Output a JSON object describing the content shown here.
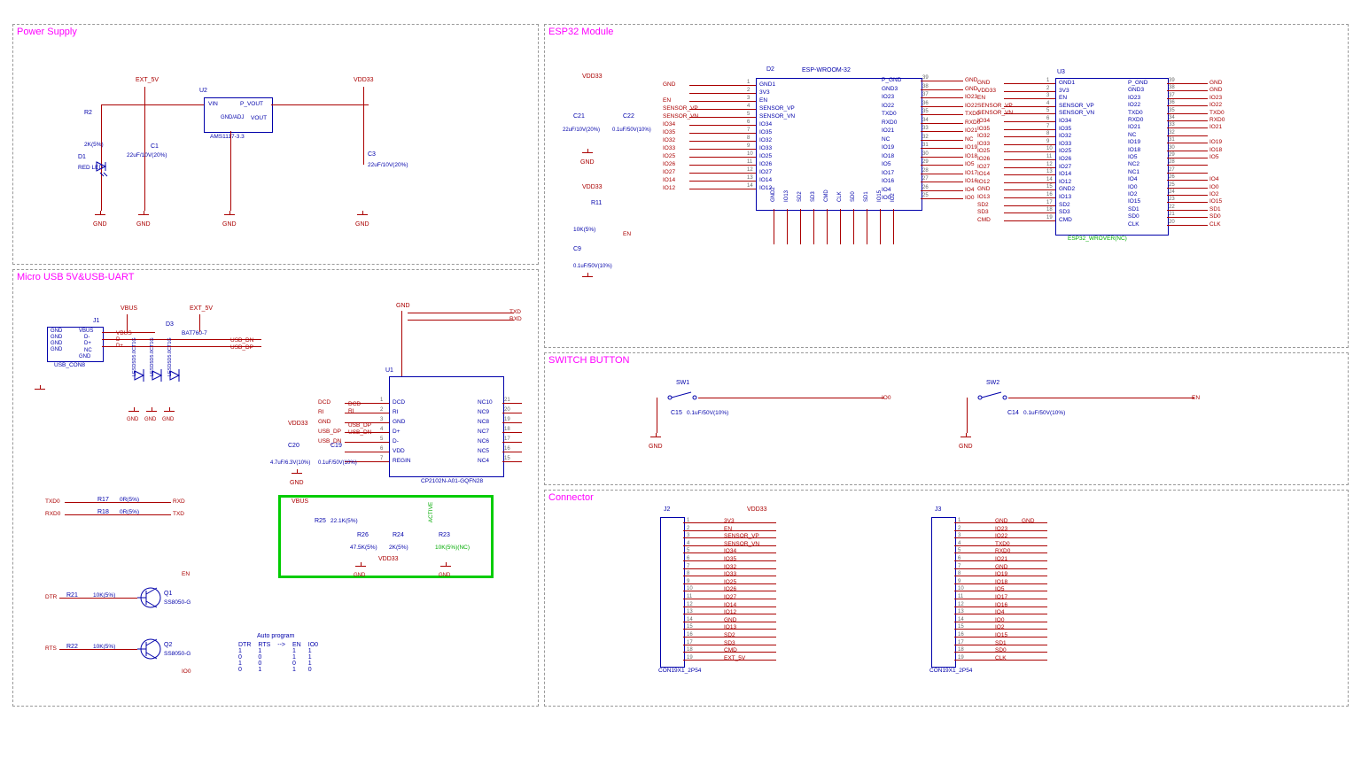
{
  "sheets": {
    "power": {
      "title": "Power Supply"
    },
    "usb": {
      "title": "Micro USB  5V&USB-UART"
    },
    "esp": {
      "title": "ESP32 Module"
    },
    "switch": {
      "title": "SWITCH BUTTON"
    },
    "conn": {
      "title": "Connector"
    }
  },
  "power": {
    "ext5v": "EXT_5V",
    "vdd33": "VDD33",
    "r2": "R2",
    "r2v": "2K(5%)",
    "d1": "D1",
    "d1v": "RED LED",
    "c1": "C1",
    "c1v": "22uF/10V(20%)",
    "c3": "C3",
    "c3v": "22uF/10V(20%)",
    "u2": "U2",
    "u2v": "AMS1117-3.3",
    "vin": "VIN",
    "gnd": "GND",
    "adj": "GND/ADJ",
    "vout": "VOUT",
    "pvout": "P_VOUT"
  },
  "usb": {
    "j1": "J1",
    "j1v": "USB_CON8",
    "vbus": "VBUS",
    "ext5v": "EXT_5V",
    "d3": "D3",
    "d3v": "BAT760-7",
    "usbdn": "USB_DN",
    "usbdp": "USB_DP",
    "d4": "LESD5D5.0CT1G",
    "d5": "LESD5D5.0CT1G",
    "d6": "LESD5D5.0CT1G",
    "vdd33": "VDD33",
    "c20": "C20",
    "c20v": "4.7uF/6.3V(10%)",
    "c19": "C19",
    "c19v": "0.1uF/50V(10%)",
    "u1": "U1",
    "u1v": "CP2102N-A01-GQFN28",
    "r17": "R17",
    "r17v": "0R(5%)",
    "r18": "R18",
    "r18v": "0R(5%)",
    "txd0": "TXD0",
    "rxd0": "RXD0",
    "rxd": "RXD",
    "txd": "TXD",
    "r25": "R25",
    "r25v": "22.1K(5%)",
    "r26": "R26",
    "r26v": "47.5K(5%)",
    "r24": "R24",
    "r24v": "2K(5%)",
    "r23": "R23",
    "r23v": "10K(5%)(NC)",
    "r21": "R21",
    "r21v": "10K(5%)",
    "r22": "R22",
    "r22v": "10K(5%)",
    "q1": "Q1",
    "q1v": "SS8050-G",
    "q2": "Q2",
    "q2v": "SS8050-G",
    "dtr": "DTR",
    "rts": "RTS",
    "en": "EN",
    "io0": "IO0",
    "auto_title": "Auto program",
    "auto_hdr": [
      "DTR",
      "RTS",
      "-->",
      "EN",
      "IO0"
    ],
    "auto_rows": [
      [
        "1",
        "1",
        "",
        "1",
        "1"
      ],
      [
        "0",
        "0",
        "",
        "1",
        "1"
      ],
      [
        "1",
        "0",
        "",
        "0",
        "1"
      ],
      [
        "0",
        "1",
        "",
        "1",
        "0"
      ]
    ],
    "dcd": "DCD",
    "ri": "RI",
    "dplus": "D+",
    "dminus": "D-",
    "vdd": "VDD",
    "regin": "REGIN",
    "pins_left": [
      "DCD",
      "RI",
      "GND",
      "D+",
      "D-",
      "VDD",
      "REGIN"
    ],
    "pins_right": [
      "NC10",
      "NC9",
      "NC8",
      "NC7",
      "NC6",
      "NC5",
      "NC4"
    ],
    "active": "ACTIVE",
    "gnd": "GND"
  },
  "esp": {
    "d2": "D2",
    "vdd33": "VDD33",
    "c21": "C21",
    "c21v": "22uF/10V(20%)",
    "c22": "C22",
    "c22v": "0.1uF/50V(10%)",
    "r11": "R11",
    "r11v": "10K(5%)",
    "c9": "C9",
    "c9v": "0.1uF/50V(10%)",
    "en": "EN",
    "wroom": "ESP-WROOM-32",
    "u3": "U3",
    "wrover": "ESP32_WROVER(NC)",
    "left_pins": [
      "GND1",
      "3V3",
      "EN",
      "SENSOR_VP",
      "SENSOR_VN",
      "IO34",
      "IO35",
      "IO32",
      "IO33",
      "IO25",
      "IO26",
      "IO27",
      "IO14",
      "IO12"
    ],
    "left_nets": [
      "GND",
      "",
      "EN",
      "SENSOR_VP",
      "SENSOR_VN",
      "IO34",
      "IO35",
      "IO32",
      "IO33",
      "IO25",
      "IO26",
      "IO27",
      "IO14",
      "IO12"
    ],
    "right_pins": [
      "P_GND",
      "GND3",
      "IO23",
      "IO22",
      "TXD0",
      "RXD0",
      "IO21",
      "NC",
      "IO19",
      "IO18",
      "IO5",
      "IO17",
      "IO16",
      "IO4",
      "IO0"
    ],
    "right_nets": [
      "GND",
      "GND",
      "IO23",
      "IO22",
      "TXD0",
      "RXD0",
      "IO21",
      "NC",
      "IO19",
      "IO18",
      "IO5",
      "IO17",
      "IO16",
      "IO4",
      "IO0"
    ],
    "bot_pins": [
      "GND2",
      "IO13",
      "SD2",
      "SD3",
      "CMD",
      "CLK",
      "SD0",
      "SD1",
      "IO15",
      "IO2"
    ],
    "u3_left": [
      "GND1",
      "3V3",
      "EN",
      "SENSOR_VP",
      "SENSOR_VN",
      "IO34",
      "IO35",
      "IO32",
      "IO33",
      "IO25",
      "IO26",
      "IO27",
      "IO14",
      "IO12",
      "GND2",
      "IO13",
      "SD2",
      "SD3",
      "CMD"
    ],
    "u3_right": [
      "P_GND",
      "GND3",
      "IO23",
      "IO22",
      "TXD0",
      "RXD0",
      "IO21",
      "NC",
      "IO19",
      "IO18",
      "IO5",
      "NC2",
      "NC1",
      "IO4",
      "IO0",
      "IO2",
      "IO15",
      "SD1",
      "SD0",
      "CLK"
    ],
    "u3_left_nets": [
      "GND",
      "VDD33",
      "EN",
      "SENSOR_VP",
      "SENSOR_VN",
      "IO34",
      "IO35",
      "IO32",
      "IO33",
      "IO25",
      "IO26",
      "IO27",
      "IO14",
      "IO12",
      "GND",
      "IO13",
      "SD2",
      "SD3",
      "CMD"
    ],
    "u3_right_nets": [
      "GND",
      "GND",
      "IO23",
      "IO22",
      "TXD0",
      "RXD0",
      "IO21",
      "",
      "IO19",
      "IO18",
      "IO5",
      "",
      "",
      "IO4",
      "IO0",
      "IO2",
      "IO15",
      "SD1",
      "SD0",
      "CLK"
    ],
    "gnd": "GND"
  },
  "switch": {
    "sw1": "SW1",
    "sw2": "SW2",
    "c15": "C15",
    "c15v": "0.1uF/50V(10%)",
    "c14": "C14",
    "c14v": "0.1uF/50V(10%)",
    "io0": "IO0",
    "en": "EN",
    "gnd": "GND"
  },
  "conn": {
    "j2": "J2",
    "j3": "J3",
    "vdd33": "VDD33",
    "contype": "CON19X1_2P54",
    "j2_nets": [
      "3V3",
      "EN",
      "SENSOR_VP",
      "SENSOR_VN",
      "IO34",
      "IO35",
      "IO32",
      "IO33",
      "IO25",
      "IO26",
      "IO27",
      "IO14",
      "IO12",
      "GND",
      "IO13",
      "SD2",
      "SD3",
      "CMD",
      "EXT_5V"
    ],
    "j3_nets": [
      "GND",
      "IO23",
      "IO22",
      "TXD0",
      "RXD0",
      "IO21",
      "GND",
      "IO19",
      "IO18",
      "IO5",
      "IO17",
      "IO16",
      "IO4",
      "IO0",
      "IO2",
      "IO15",
      "SD1",
      "SD0",
      "CLK"
    ]
  }
}
